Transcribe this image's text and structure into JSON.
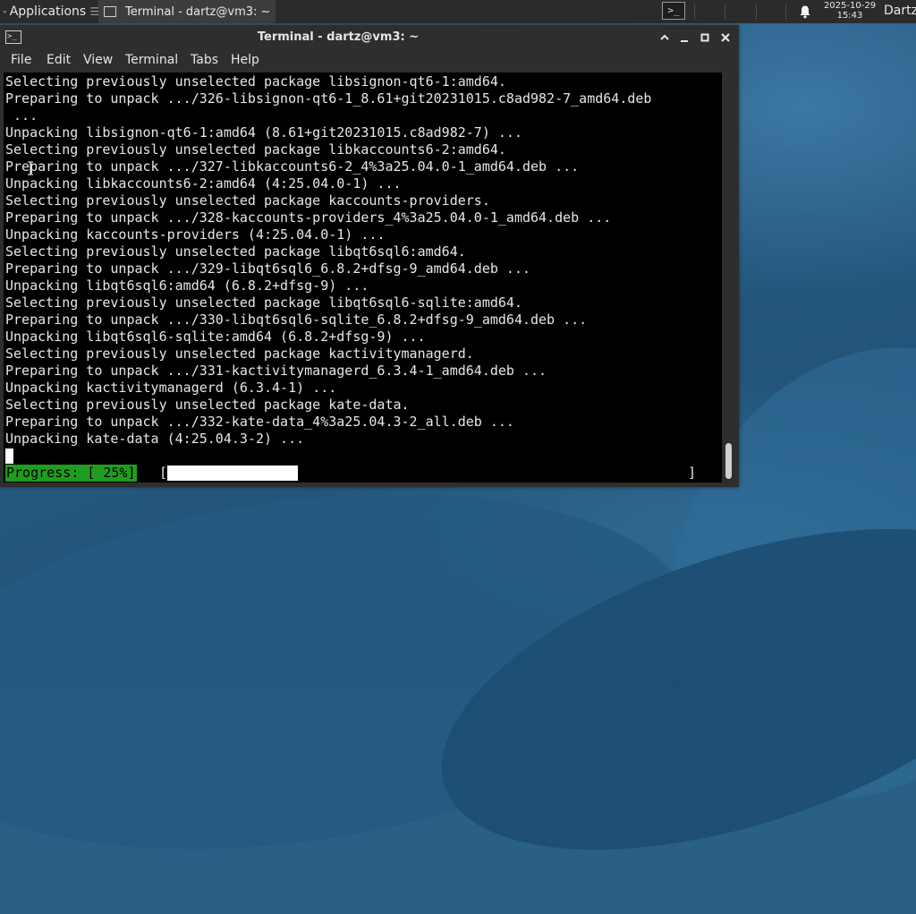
{
  "panel": {
    "applications_label": "Applications",
    "applications_suffix": "☰",
    "task_title": "Terminal - dartz@vm3: ~",
    "clock_date": "2025-10-29",
    "clock_time": "15:43",
    "user_name": "Dartz"
  },
  "window": {
    "title": "Terminal - dartz@vm3: ~",
    "menu": [
      "File",
      "Edit",
      "View",
      "Terminal",
      "Tabs",
      "Help"
    ]
  },
  "console": {
    "lines": [
      "Selecting previously unselected package libsignon-qt6-1:amd64.",
      "Preparing to unpack .../326-libsignon-qt6-1_8.61+git20231015.c8ad982-7_amd64.deb",
      " ...",
      "Unpacking libsignon-qt6-1:amd64 (8.61+git20231015.c8ad982-7) ...",
      "Selecting previously unselected package libkaccounts6-2:amd64.",
      "Preparing to unpack .../327-libkaccounts6-2_4%3a25.04.0-1_amd64.deb ...",
      "Unpacking libkaccounts6-2:amd64 (4:25.04.0-1) ...",
      "Selecting previously unselected package kaccounts-providers.",
      "Preparing to unpack .../328-kaccounts-providers_4%3a25.04.0-1_amd64.deb ...",
      "Unpacking kaccounts-providers (4:25.04.0-1) ...",
      "Selecting previously unselected package libqt6sql6:amd64.",
      "Preparing to unpack .../329-libqt6sql6_6.8.2+dfsg-9_amd64.deb ...",
      "Unpacking libqt6sql6:amd64 (6.8.2+dfsg-9) ...",
      "Selecting previously unselected package libqt6sql6-sqlite:amd64.",
      "Preparing to unpack .../330-libqt6sql6-sqlite_6.8.2+dfsg-9_amd64.deb ...",
      "Unpacking libqt6sql6-sqlite:amd64 (6.8.2+dfsg-9) ...",
      "Selecting previously unselected package kactivitymanagerd.",
      "Preparing to unpack .../331-kactivitymanagerd_6.3.4-1_amd64.deb ...",
      "Unpacking kactivitymanagerd (6.3.4-1) ...",
      "Selecting previously unselected package kate-data.",
      "Preparing to unpack .../332-kate-data_4%3a25.04.3-2_all.deb ...",
      "Unpacking kate-data (4:25.04.3-2) ..."
    ],
    "progress_label": "Progress: [ 25%]",
    "bracket_open": "[",
    "bracket_close": "]",
    "progress_fraction": 0.25
  },
  "colors": {
    "panel_bg": "#2b2b2b",
    "window_bg": "#2e2e2e",
    "console_bg": "#000000",
    "console_fg": "#e6e6e6",
    "progress_label_bg": "#1f9d1f",
    "progress_fill": "#ffffff"
  },
  "icons": [
    "xfce-mouse-icon",
    "terminal-icon",
    "bell-icon",
    "maximize-icon",
    "minimize-icon",
    "restore-icon",
    "close-icon"
  ]
}
